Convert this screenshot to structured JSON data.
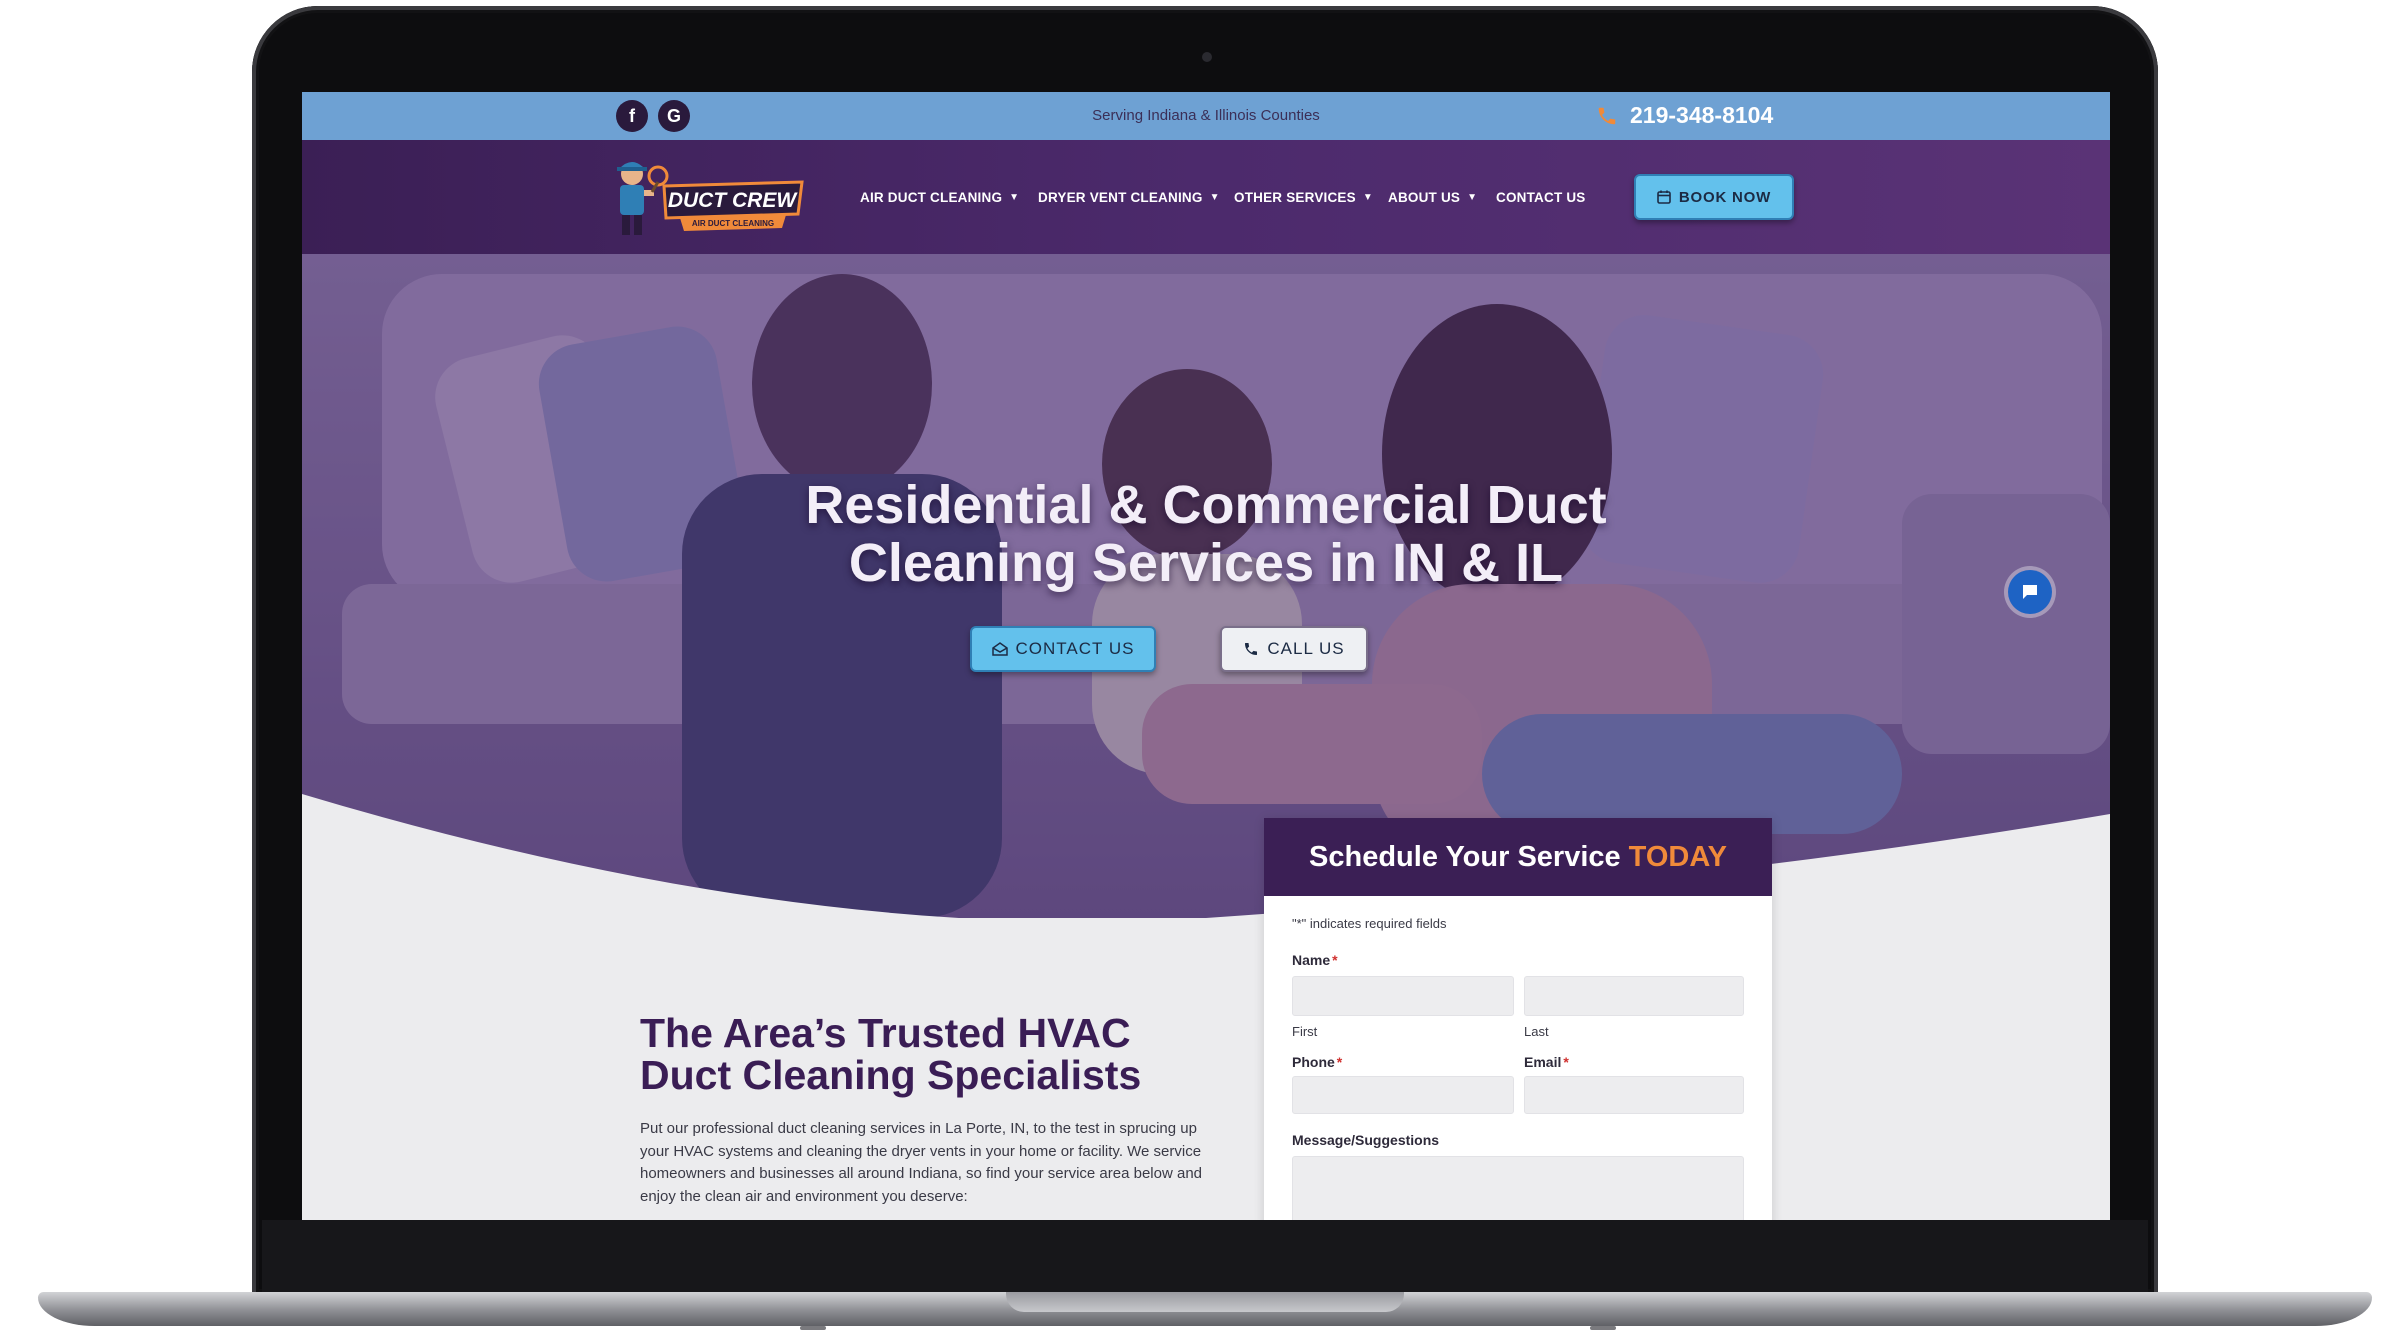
{
  "topbar": {
    "social": [
      {
        "name": "facebook",
        "glyph": "f"
      },
      {
        "name": "google",
        "glyph": "G"
      }
    ],
    "serving_text": "Serving Indiana & Illinois Counties",
    "phone": "219-348-8104"
  },
  "nav": {
    "logo_main": "DUCT CREW",
    "logo_sub": "AIR DUCT CLEANING",
    "items": [
      {
        "label": "AIR DUCT CLEANING",
        "dropdown": true
      },
      {
        "label": "DRYER VENT CLEANING",
        "dropdown": true
      },
      {
        "label": "OTHER SERVICES",
        "dropdown": true
      },
      {
        "label": "ABOUT US",
        "dropdown": true
      },
      {
        "label": "CONTACT US",
        "dropdown": false
      }
    ],
    "book_button": "BOOK NOW"
  },
  "hero": {
    "title_line1": "Residential & Commercial Duct",
    "title_line2": "Cleaning Services in IN & IL",
    "contact_button": "CONTACT US",
    "call_button": "CALL US"
  },
  "about": {
    "title_line1": "The Area’s Trusted HVAC",
    "title_line2": "Duct Cleaning Specialists",
    "body": "Put our professional duct cleaning services in La Porte, IN, to the test in sprucing up your HVAC systems and cleaning the dryer vents in your home or facility. We service homeowners and businesses all around Indiana, so find your service area below and enjoy the clean air and environment you deserve:"
  },
  "form": {
    "heading": "Schedule Your Service",
    "heading_highlight": "TODAY",
    "required_note": "\"*\" indicates required fields",
    "name_label": "Name",
    "first_label": "First",
    "last_label": "Last",
    "phone_label": "Phone",
    "email_label": "Email",
    "message_label": "Message/Suggestions",
    "required_mark": "*"
  },
  "colors": {
    "topbar": "#6ea1d3",
    "nav_purple": "#4c2a6c",
    "accent_blue": "#63c1ec",
    "accent_orange": "#f08a3a",
    "heading_purple": "#3a1d55"
  }
}
